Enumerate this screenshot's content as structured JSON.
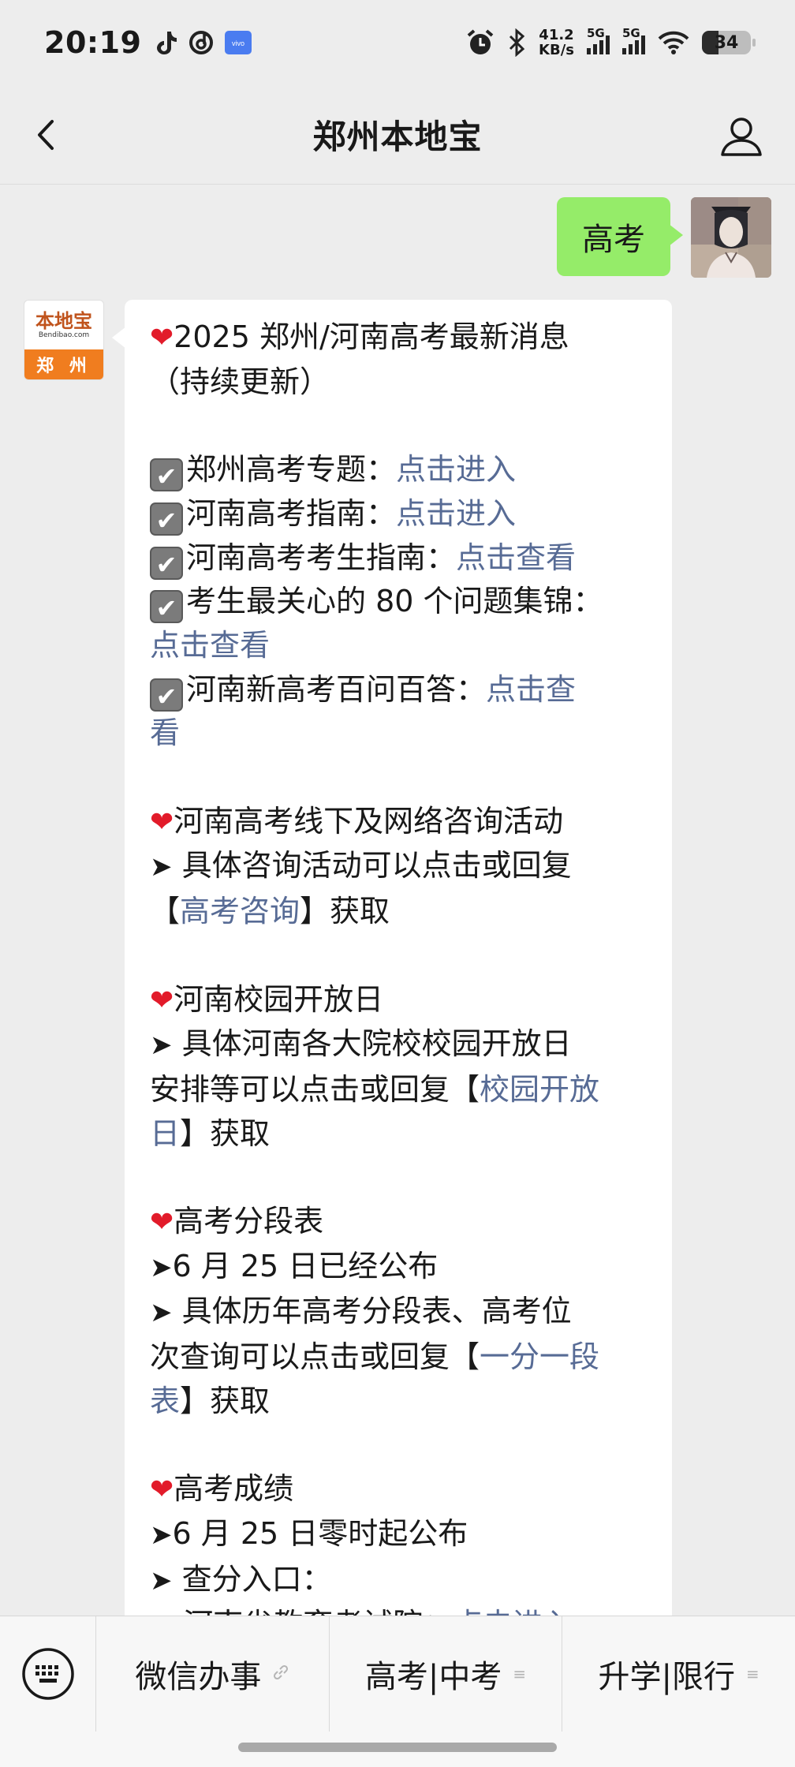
{
  "status_bar": {
    "time": "20:19",
    "net_speed_value": "41.2",
    "net_speed_unit": "KB/s",
    "sim1_label": "5G",
    "sim2_label": "5G",
    "battery": "34",
    "left_icons": [
      "tiktok-icon",
      "music-icon",
      "vivo-icon"
    ],
    "right_icons": [
      "alarm-icon",
      "bluetooth-icon",
      "signal-icon",
      "wifi-icon",
      "battery-icon"
    ]
  },
  "nav": {
    "title": "郑州本地宝"
  },
  "chat": {
    "outgoing_message": "高考",
    "brand_avatar": {
      "name": "本地宝",
      "url": "Bendibao.com",
      "city": "郑 州"
    },
    "reply": {
      "line01_heart": "❤️",
      "line01": "2025 郑州/河南高考最新消息",
      "line02": "（持续更新）",
      "item1_text": "郑州高考专题：",
      "item1_link": "点击进入",
      "item2_text": "河南高考指南：",
      "item2_link": "点击进入",
      "item3_text": "河南高考考生指南：",
      "item3_link": "点击查看",
      "item4_text": "考生最关心的 80 个问题集锦：",
      "item4_link": "点击查看",
      "item5_text": "河南新高考百问百答：",
      "item5_link_a": "点击查",
      "item5_link_b": "看",
      "sec1_title": "河南高考线下及网络咨询活动",
      "sec1_line1": "具体咨询活动可以点击或回复",
      "sec1_open": "【",
      "sec1_link": "高考咨询",
      "sec1_close": "】获取",
      "sec2_title": "河南校园开放日",
      "sec2_line1": "具体河南各大院校校园开放日",
      "sec2_line2a": "安排等可以点击或回复【",
      "sec2_link_a": "校园开放",
      "sec2_link_b": "日",
      "sec2_close": "】获取",
      "sec3_title": "高考分段表",
      "sec3_line1": "6 月 25 日已经公布",
      "sec3_line2": "具体历年高考分段表、高考位",
      "sec3_line3a": "次查询可以点击或回复【",
      "sec3_link_a": "一分一段",
      "sec3_link_b": "表",
      "sec3_close": "】获取",
      "sec4_title": "高考成绩",
      "sec4_line1": "6 月 25 日零时起公布",
      "sec4_line2": "查分入口：",
      "sec4_item1_num": "1",
      "sec4_item1_text": "河南省教育考试院：",
      "sec4_item1_link": "点击进入",
      "arrow": "➤",
      "check": "✔"
    }
  },
  "bottom_menu": {
    "items": [
      {
        "label": "微信办事",
        "suffix": "🔗"
      },
      {
        "label": "高考|中考",
        "suffix": "≡"
      },
      {
        "label": "升学|限行",
        "suffix": "≡"
      }
    ]
  }
}
